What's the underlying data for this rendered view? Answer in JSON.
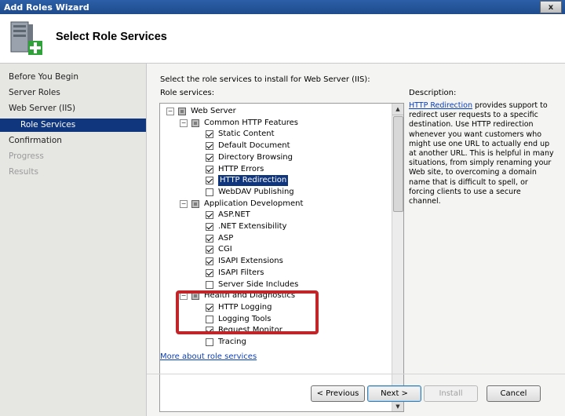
{
  "window": {
    "title": "Add Roles Wizard",
    "close_glyph": "x"
  },
  "header": {
    "title": "Select Role Services",
    "icon": "server-add-icon"
  },
  "nav": [
    {
      "label": "Before You Begin",
      "state": "normal"
    },
    {
      "label": "Server Roles",
      "state": "normal"
    },
    {
      "label": "Web Server (IIS)",
      "state": "normal"
    },
    {
      "label": "Role Services",
      "state": "selected"
    },
    {
      "label": "Confirmation",
      "state": "normal"
    },
    {
      "label": "Progress",
      "state": "disabled"
    },
    {
      "label": "Results",
      "state": "disabled"
    }
  ],
  "main": {
    "instruction": "Select the role services to install for Web Server (IIS):",
    "role_services_label": "Role services:",
    "more_link": "More about role services"
  },
  "tree": [
    {
      "label": "Web Server",
      "level": 0,
      "expander": "−",
      "state": "partial"
    },
    {
      "label": "Common HTTP Features",
      "level": 1,
      "expander": "−",
      "state": "partial"
    },
    {
      "label": "Static Content",
      "level": 2,
      "state": "checked"
    },
    {
      "label": "Default Document",
      "level": 2,
      "state": "checked"
    },
    {
      "label": "Directory Browsing",
      "level": 2,
      "state": "checked"
    },
    {
      "label": "HTTP Errors",
      "level": 2,
      "state": "checked"
    },
    {
      "label": "HTTP Redirection",
      "level": 2,
      "state": "checked",
      "selected": true
    },
    {
      "label": "WebDAV Publishing",
      "level": 2,
      "state": "unchecked"
    },
    {
      "label": "Application Development",
      "level": 1,
      "expander": "−",
      "state": "partial"
    },
    {
      "label": "ASP.NET",
      "level": 2,
      "state": "checked"
    },
    {
      "label": ".NET Extensibility",
      "level": 2,
      "state": "checked"
    },
    {
      "label": "ASP",
      "level": 2,
      "state": "checked"
    },
    {
      "label": "CGI",
      "level": 2,
      "state": "checked"
    },
    {
      "label": "ISAPI Extensions",
      "level": 2,
      "state": "checked"
    },
    {
      "label": "ISAPI Filters",
      "level": 2,
      "state": "checked"
    },
    {
      "label": "Server Side Includes",
      "level": 2,
      "state": "unchecked"
    },
    {
      "label": "Health and Diagnostics",
      "level": 1,
      "expander": "−",
      "state": "partial"
    },
    {
      "label": "HTTP Logging",
      "level": 2,
      "state": "checked"
    },
    {
      "label": "Logging Tools",
      "level": 2,
      "state": "unchecked"
    },
    {
      "label": "Request Monitor",
      "level": 2,
      "state": "checked"
    },
    {
      "label": "Tracing",
      "level": 2,
      "state": "unchecked"
    }
  ],
  "description": {
    "title": "Description:",
    "link": "HTTP Redirection",
    "text": " provides support to redirect user requests to a specific destination. Use HTTP redirection whenever you want customers who might use one URL to actually end up at another URL. This is helpful in many situations, from simply renaming your Web site, to overcoming a domain name that is difficult to spell, or forcing clients to use a secure channel."
  },
  "buttons": {
    "previous": "< Previous",
    "next": "Next >",
    "install": "Install",
    "cancel": "Cancel"
  },
  "colors": {
    "selection": "#10367e",
    "highlight_box": "#c0252a",
    "link": "#0b3fb8"
  }
}
